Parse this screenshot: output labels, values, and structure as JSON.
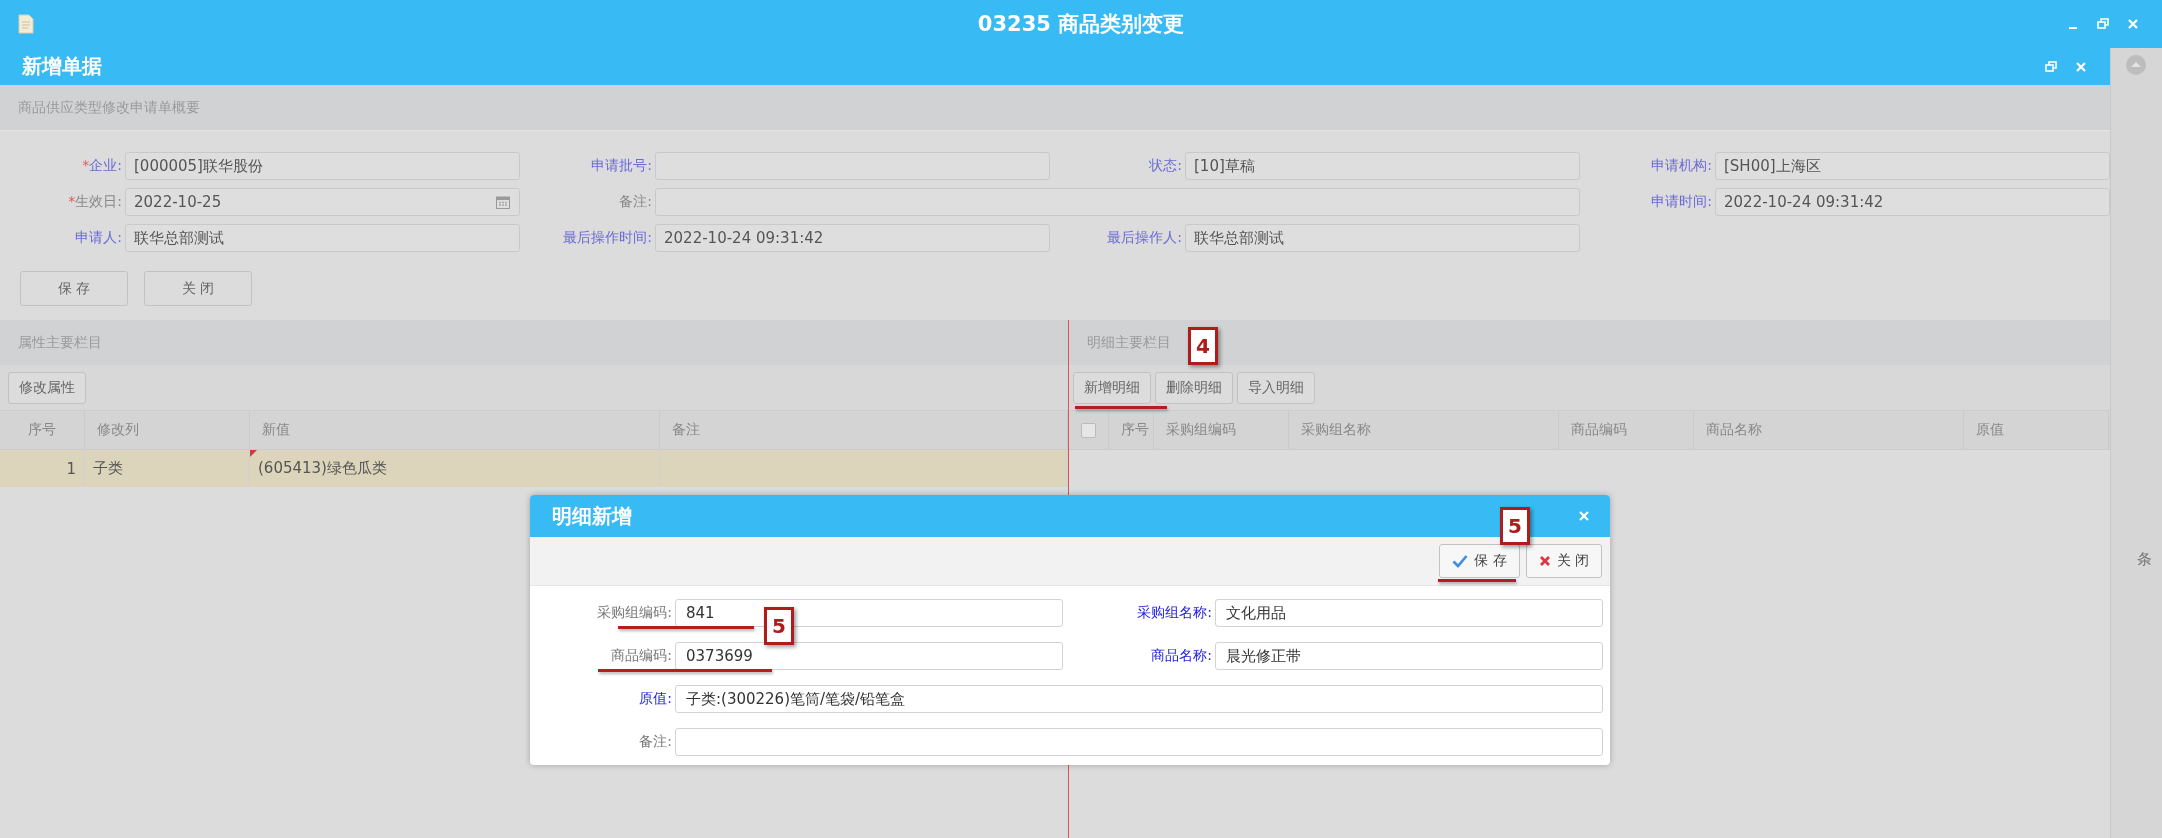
{
  "window": {
    "title": "03235 商品类别变更"
  },
  "document": {
    "title": "新增单据"
  },
  "summary": {
    "title": "商品供应类型修改申请单概要",
    "fields": [
      {
        "required_mark": "*",
        "label": "企业:",
        "value": "[000005]联华股份",
        "accent": true,
        "kind": "text"
      },
      {
        "label": "申请批号:",
        "accent": true,
        "kind": "text"
      },
      {
        "label": "状态:",
        "value": "[10]草稿",
        "accent": true,
        "kind": "text"
      },
      {
        "label": "申请机构:",
        "value": "[SH00]上海区",
        "accent": true,
        "kind": "text"
      },
      {
        "required_mark": "*",
        "label": "生效日:",
        "value": "2022-10-25",
        "accent": false,
        "kind": "date"
      },
      {
        "label": "备注:",
        "accent": false,
        "kind": "memo"
      },
      {
        "label": "申请时间:",
        "value": "2022-10-24 09:31:42",
        "accent": true,
        "kind": "text"
      },
      {
        "label": "申请人:",
        "value": "联华总部测试",
        "accent": true,
        "kind": "text"
      },
      {
        "label": "最后操作时间:",
        "value": "2022-10-24 09:31:42",
        "accent": true,
        "kind": "text"
      },
      {
        "label": "最后操作人:",
        "value": "联华总部测试",
        "accent": true,
        "kind": "text"
      }
    ],
    "buttons": [
      "保 存",
      "关 闭"
    ]
  },
  "attributes": {
    "title": "属性主要栏目",
    "buttons": [
      "修改属性"
    ],
    "columns": [
      "序号",
      "修改列",
      "新值",
      "备注"
    ],
    "rows": [
      {
        "cells": [
          "1",
          "子类",
          "(605413)绿色瓜类",
          ""
        ],
        "selected": true,
        "edited": true
      }
    ]
  },
  "details": {
    "title": "明细主要栏目",
    "buttons": [
      "新增明细",
      "删除明细",
      "导入明细"
    ],
    "select_all": {
      "checked": false
    },
    "columns": [
      "序号",
      "采购组编码",
      "采购组名称",
      "商品编码",
      "商品名称",
      "原值"
    ]
  },
  "side": {
    "text": "条"
  },
  "dialog": {
    "title": "明细新增",
    "buttons": [
      {
        "label": "保 存",
        "kind": "save"
      },
      {
        "label": "关 闭",
        "kind": "close"
      }
    ],
    "fields": [
      {
        "label": "采购组编码:",
        "value": "841",
        "accent": false,
        "kind": "half"
      },
      {
        "label": "采购组名称:",
        "value": "文化用品",
        "accent": true,
        "kind": "half"
      },
      {
        "label": "商品编码:",
        "value": "0373699",
        "accent": false,
        "kind": "half"
      },
      {
        "label": "商品名称:",
        "value": "晨光修正带",
        "accent": true,
        "kind": "half"
      },
      {
        "label": "原值:",
        "value": "子类:(300226)笔筒/笔袋/铅笔盒",
        "accent": true,
        "kind": "wide"
      },
      {
        "label": "备注:",
        "accent": false,
        "kind": "wide"
      }
    ]
  },
  "annotations": [
    {
      "number": "4"
    },
    {
      "number": "5"
    },
    {
      "number": "5"
    }
  ]
}
